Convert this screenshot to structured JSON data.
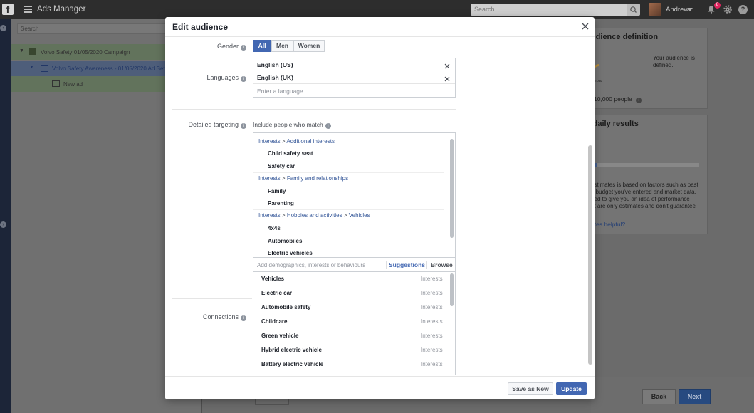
{
  "app": {
    "title": "Ads Manager",
    "logo_letter": "f",
    "search_placeholder": "Search",
    "user_name": "Andrew",
    "notification_count": "8"
  },
  "campaign_tree": {
    "search_placeholder": "Search",
    "campaign": "Volvo Safety 01/05/2020 Campaign",
    "ad_set": "Volvo Safety Awareness - 01/05/2020 Ad Set",
    "ad": "New ad"
  },
  "background_panels": {
    "definition_title": "Audience definition",
    "definition_text_1": "Your audience is",
    "definition_text_2": "defined.",
    "definition_gauge_label": "Broad",
    "potential_reach": "10,000 people",
    "daily_title": "Estimated daily results",
    "estimate_lines": [
      "estimates is based on factors such as past",
      "e budget you've entered and market data.",
      "ded to give you an idea of performance",
      "ut are only estimates and don't guarantee"
    ],
    "helpful_link": "ates helpful?",
    "back_label": "Back",
    "next_label": "Next"
  },
  "modal": {
    "title": "Edit audience",
    "gender": {
      "label": "Gender",
      "options": [
        "All",
        "Men",
        "Women"
      ],
      "selected": "All"
    },
    "languages": {
      "label": "Languages",
      "selected": [
        "English (US)",
        "English (UK)"
      ],
      "placeholder": "Enter a language..."
    },
    "detailed_targeting": {
      "label": "Detailed targeting",
      "include_label": "Include people who match",
      "groups": [
        {
          "path": [
            "Interests",
            "Additional interests"
          ],
          "items": [
            "Child safety seat",
            "Safety car"
          ]
        },
        {
          "path": [
            "Interests",
            "Family and relationships"
          ],
          "items": [
            "Family",
            "Parenting"
          ]
        },
        {
          "path": [
            "Interests",
            "Hobbies and activities",
            "Vehicles"
          ],
          "items": [
            "4x4s",
            "Automobiles",
            "Electric vehicles"
          ]
        }
      ],
      "input_placeholder": "Add demographics, interests or behaviours",
      "suggestions_label": "Suggestions",
      "browse_label": "Browse",
      "suggestions": [
        {
          "name": "Vehicles",
          "type": "Interests"
        },
        {
          "name": "Electric car",
          "type": "Interests"
        },
        {
          "name": "Automobile safety",
          "type": "Interests"
        },
        {
          "name": "Childcare",
          "type": "Interests"
        },
        {
          "name": "Green vehicle",
          "type": "Interests"
        },
        {
          "name": "Hybrid electric vehicle",
          "type": "Interests"
        },
        {
          "name": "Battery electric vehicle",
          "type": "Interests"
        }
      ]
    },
    "connections": {
      "label": "Connections"
    },
    "footer": {
      "save_as_new_label": "Save as New",
      "update_label": "Update"
    }
  },
  "colors": {
    "accent": "#4267b2",
    "link": "#365899",
    "topbar": "#2d2d2d"
  }
}
